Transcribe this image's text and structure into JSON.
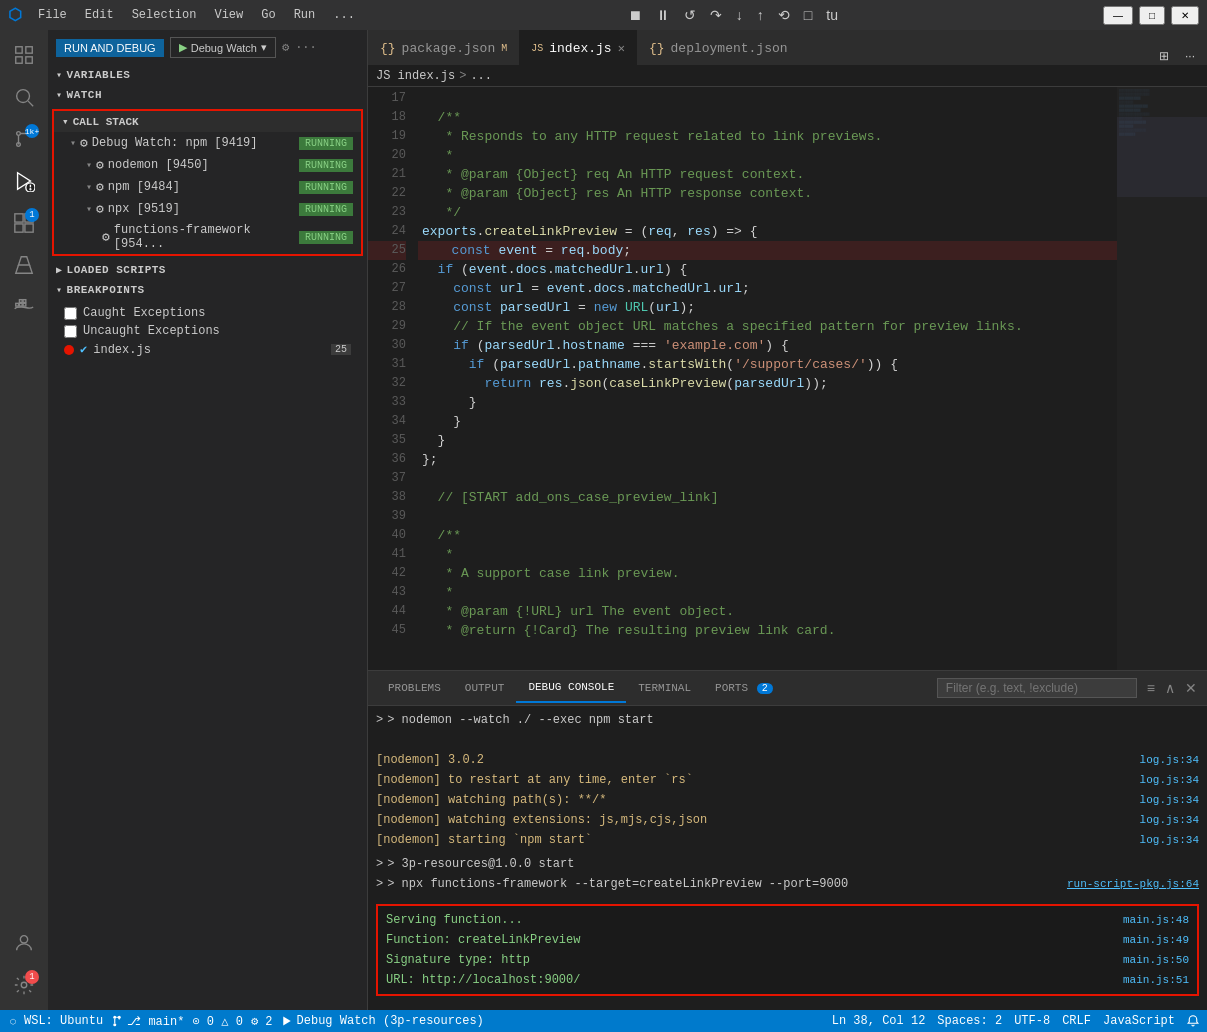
{
  "titleBar": {
    "logo": "⬡",
    "menus": [
      "File",
      "Edit",
      "Selection",
      "View",
      "Go",
      "Run",
      "..."
    ],
    "windowButtons": [
      "—",
      "□",
      "✕"
    ]
  },
  "debugControls": {
    "buttons": [
      "⏸",
      "⏸",
      "↺",
      "↓",
      "↑",
      "⟲",
      "□",
      "⬡",
      "tu"
    ]
  },
  "sidebar": {
    "runAndDebugLabel": "RUN AND DEBUG",
    "runBtn": "▶",
    "debugWatchLabel": "Debug Watch",
    "settingsIcon": "⚙",
    "moreIcon": "···",
    "variablesLabel": "VARIABLES",
    "watchLabel": "WATCH",
    "callStackLabel": "CALL STACK",
    "callStackItems": [
      {
        "label": "Debug Watch: npm [9419]",
        "status": "RUNNING",
        "level": 0
      },
      {
        "label": "nodemon [9450]",
        "status": "RUNNING",
        "level": 1
      },
      {
        "label": "npm [9484]",
        "status": "RUNNING",
        "level": 1
      },
      {
        "label": "npx [9519]",
        "status": "RUNNING",
        "level": 1
      },
      {
        "label": "functions-framework [954...",
        "status": "RUNNING",
        "level": 2
      }
    ],
    "loadedScriptsLabel": "LOADED SCRIPTS",
    "breakpointsLabel": "BREAKPOINTS",
    "breakpoints": [
      {
        "label": "Caught Exceptions",
        "checked": false,
        "type": "checkbox"
      },
      {
        "label": "Uncaught Exceptions",
        "checked": false,
        "type": "checkbox"
      },
      {
        "label": "index.js",
        "checked": true,
        "type": "dot",
        "count": "25"
      }
    ]
  },
  "tabs": [
    {
      "label": "package.json",
      "icon": "{}",
      "modified": true,
      "active": false
    },
    {
      "label": "index.js",
      "icon": "JS",
      "modified": false,
      "active": true,
      "close": true
    },
    {
      "label": "deployment.json",
      "icon": "{}",
      "modified": false,
      "active": false
    }
  ],
  "breadcrumb": {
    "parts": [
      "JS index.js",
      ">",
      "..."
    ]
  },
  "codeLines": [
    {
      "num": "17",
      "content": ""
    },
    {
      "num": "18",
      "tokens": [
        {
          "t": "cmt",
          "v": "  /**"
        }
      ]
    },
    {
      "num": "19",
      "tokens": [
        {
          "t": "cmt",
          "v": "   * Responds to any HTTP request related to link previews."
        }
      ]
    },
    {
      "num": "20",
      "tokens": [
        {
          "t": "cmt",
          "v": "   *"
        }
      ]
    },
    {
      "num": "21",
      "tokens": [
        {
          "t": "cmt",
          "v": "   * @param {Object} req An HTTP request context."
        }
      ]
    },
    {
      "num": "22",
      "tokens": [
        {
          "t": "cmt",
          "v": "   * @param {Object} res An HTTP response context."
        }
      ]
    },
    {
      "num": "23",
      "tokens": [
        {
          "t": "cmt",
          "v": "   */"
        }
      ]
    },
    {
      "num": "24",
      "tokens": [
        {
          "t": "var",
          "v": "exports"
        },
        {
          "t": "op",
          "v": "."
        },
        {
          "t": "fn",
          "v": "createLinkPreview"
        },
        {
          "t": "op",
          "v": " = ("
        },
        {
          "t": "param",
          "v": "req"
        },
        {
          "t": "op",
          "v": ", "
        },
        {
          "t": "param",
          "v": "res"
        },
        {
          "t": "op",
          "v": ") => {"
        }
      ]
    },
    {
      "num": "25",
      "tokens": [
        {
          "t": "op",
          "v": "  "
        },
        {
          "t": "kw",
          "v": "const"
        },
        {
          "t": "op",
          "v": " "
        },
        {
          "t": "var",
          "v": "event"
        },
        {
          "t": "op",
          "v": " = "
        },
        {
          "t": "var",
          "v": "req"
        },
        {
          "t": "op",
          "v": "."
        },
        {
          "t": "var",
          "v": "body"
        },
        {
          "t": "op",
          "v": ";"
        }
      ],
      "breakpoint": true
    },
    {
      "num": "26",
      "tokens": [
        {
          "t": "op",
          "v": "  "
        },
        {
          "t": "kw",
          "v": "if"
        },
        {
          "t": "op",
          "v": " ("
        },
        {
          "t": "var",
          "v": "event"
        },
        {
          "t": "op",
          "v": "."
        },
        {
          "t": "var",
          "v": "docs"
        },
        {
          "t": "op",
          "v": "."
        },
        {
          "t": "var",
          "v": "matchedUrl"
        },
        {
          "t": "op",
          "v": "."
        },
        {
          "t": "var",
          "v": "url"
        },
        {
          "t": "op",
          "v": ") {"
        }
      ]
    },
    {
      "num": "27",
      "tokens": [
        {
          "t": "op",
          "v": "    "
        },
        {
          "t": "kw",
          "v": "const"
        },
        {
          "t": "op",
          "v": " "
        },
        {
          "t": "var",
          "v": "url"
        },
        {
          "t": "op",
          "v": " = "
        },
        {
          "t": "var",
          "v": "event"
        },
        {
          "t": "op",
          "v": "."
        },
        {
          "t": "var",
          "v": "docs"
        },
        {
          "t": "op",
          "v": "."
        },
        {
          "t": "var",
          "v": "matchedUrl"
        },
        {
          "t": "op",
          "v": "."
        },
        {
          "t": "var",
          "v": "url"
        },
        {
          "t": "op",
          "v": ";"
        }
      ]
    },
    {
      "num": "28",
      "tokens": [
        {
          "t": "op",
          "v": "    "
        },
        {
          "t": "kw",
          "v": "const"
        },
        {
          "t": "op",
          "v": " "
        },
        {
          "t": "var",
          "v": "parsedUrl"
        },
        {
          "t": "op",
          "v": " = "
        },
        {
          "t": "kw",
          "v": "new"
        },
        {
          "t": "op",
          "v": " "
        },
        {
          "t": "type",
          "v": "URL"
        },
        {
          "t": "op",
          "v": "("
        },
        {
          "t": "var",
          "v": "url"
        },
        {
          "t": "op",
          "v": ");"
        }
      ]
    },
    {
      "num": "29",
      "tokens": [
        {
          "t": "cmt",
          "v": "    // If the event object URL matches a specified pattern for preview links."
        }
      ]
    },
    {
      "num": "30",
      "tokens": [
        {
          "t": "op",
          "v": "    "
        },
        {
          "t": "kw",
          "v": "if"
        },
        {
          "t": "op",
          "v": " ("
        },
        {
          "t": "var",
          "v": "parsedUrl"
        },
        {
          "t": "op",
          "v": "."
        },
        {
          "t": "var",
          "v": "hostname"
        },
        {
          "t": "op",
          "v": " === "
        },
        {
          "t": "str",
          "v": "'example.com'"
        },
        {
          "t": "op",
          "v": ") {"
        }
      ]
    },
    {
      "num": "31",
      "tokens": [
        {
          "t": "op",
          "v": "      "
        },
        {
          "t": "kw",
          "v": "if"
        },
        {
          "t": "op",
          "v": " ("
        },
        {
          "t": "var",
          "v": "parsedUrl"
        },
        {
          "t": "op",
          "v": "."
        },
        {
          "t": "var",
          "v": "pathname"
        },
        {
          "t": "op",
          "v": "."
        },
        {
          "t": "fn",
          "v": "startsWith"
        },
        {
          "t": "op",
          "v": "("
        },
        {
          "t": "str",
          "v": "'/support/cases/'"
        },
        {
          "t": "op",
          "v": ")) {"
        }
      ]
    },
    {
      "num": "32",
      "tokens": [
        {
          "t": "op",
          "v": "        "
        },
        {
          "t": "kw",
          "v": "return"
        },
        {
          "t": "op",
          "v": " "
        },
        {
          "t": "var",
          "v": "res"
        },
        {
          "t": "op",
          "v": "."
        },
        {
          "t": "fn",
          "v": "json"
        },
        {
          "t": "op",
          "v": "("
        },
        {
          "t": "fn",
          "v": "caseLinkPreview"
        },
        {
          "t": "op",
          "v": "("
        },
        {
          "t": "var",
          "v": "parsedUrl"
        },
        {
          "t": "op",
          "v": "));"
        }
      ]
    },
    {
      "num": "33",
      "tokens": [
        {
          "t": "op",
          "v": "      }"
        }
      ]
    },
    {
      "num": "34",
      "tokens": [
        {
          "t": "op",
          "v": "    }"
        }
      ]
    },
    {
      "num": "35",
      "tokens": [
        {
          "t": "op",
          "v": "  }"
        }
      ]
    },
    {
      "num": "36",
      "tokens": [
        {
          "t": "op",
          "v": "};"
        }
      ]
    },
    {
      "num": "37",
      "content": ""
    },
    {
      "num": "38",
      "tokens": [
        {
          "t": "cmt",
          "v": "  // [START add_ons_case_preview_link]"
        }
      ]
    },
    {
      "num": "39",
      "content": ""
    },
    {
      "num": "40",
      "tokens": [
        {
          "t": "cmt",
          "v": "  /**"
        }
      ]
    },
    {
      "num": "41",
      "tokens": [
        {
          "t": "cmt",
          "v": "   *"
        }
      ]
    },
    {
      "num": "42",
      "tokens": [
        {
          "t": "cmt",
          "v": "   * A support case link preview."
        }
      ]
    },
    {
      "num": "43",
      "tokens": [
        {
          "t": "cmt",
          "v": "   *"
        }
      ]
    },
    {
      "num": "44",
      "tokens": [
        {
          "t": "cmt",
          "v": "   * @param {!URL} url The event object."
        }
      ]
    },
    {
      "num": "45",
      "tokens": [
        {
          "t": "cmt",
          "v": "   * @return {!Card} The resulting preview link card."
        }
      ]
    }
  ],
  "panel": {
    "tabs": [
      "PROBLEMS",
      "OUTPUT",
      "DEBUG CONSOLE",
      "TERMINAL",
      "PORTS"
    ],
    "portsCount": "2",
    "activeTab": "DEBUG CONSOLE",
    "filterPlaceholder": "Filter (e.g. text, !exclude)",
    "consoleLines": [
      {
        "type": "cmd",
        "text": "> nodemon --watch ./ --exec npm start",
        "ref": ""
      },
      {
        "type": "blank",
        "text": "",
        "ref": ""
      },
      {
        "type": "yellow",
        "text": "[nodemon] 3.0.2",
        "ref": "log.js:34"
      },
      {
        "type": "yellow",
        "text": "[nodemon] to restart at any time, enter `rs`",
        "ref": "log.js:34"
      },
      {
        "type": "yellow",
        "text": "[nodemon] watching path(s): **/*",
        "ref": "log.js:34"
      },
      {
        "type": "yellow",
        "text": "[nodemon] watching extensions: js,mjs,cjs,json",
        "ref": "log.js:34"
      },
      {
        "type": "yellow",
        "text": "[nodemon] starting `npm start`",
        "ref": "log.js:34"
      },
      {
        "type": "blank",
        "text": "",
        "ref": ""
      },
      {
        "type": "cmd",
        "text": "> 3p-resources@1.0.0 start",
        "ref": ""
      },
      {
        "type": "cmd",
        "text": "> npx functions-framework --target=createLinkPreview --port=9000",
        "ref": ""
      },
      {
        "type": "blank",
        "text": "",
        "ref": ""
      }
    ],
    "highlightedLines": [
      {
        "text": "Serving function...",
        "ref": "main.js:48"
      },
      {
        "text": "Function: createLinkPreview",
        "ref": "main.js:49"
      },
      {
        "text": "Signature type: http",
        "ref": "main.js:50"
      },
      {
        "text": "URL: http://localhost:9000/",
        "ref": "main.js:51"
      }
    ]
  },
  "statusBar": {
    "left": [
      "WSL: Ubuntu",
      "⎇ main*",
      "⊙ 0 △ 0",
      "⚙ 2",
      "Debug Watch (3p-resources)"
    ],
    "right": [
      "Ln 38, Col 12",
      "Spaces: 2",
      "UTF-8",
      "CRLF",
      "JavaScript"
    ]
  },
  "activityBar": {
    "icons": [
      {
        "name": "explorer",
        "symbol": "⎘",
        "active": false
      },
      {
        "name": "search",
        "symbol": "🔍",
        "active": false
      },
      {
        "name": "source-control",
        "symbol": "⎇",
        "badge": "1k+"
      },
      {
        "name": "run-debug",
        "symbol": "▶",
        "active": true
      },
      {
        "name": "extensions",
        "symbol": "⊞",
        "badge": "1"
      },
      {
        "name": "testing",
        "symbol": "⚗",
        "active": false
      },
      {
        "name": "docker",
        "symbol": "🐋",
        "active": false
      },
      {
        "name": "account",
        "symbol": "👤",
        "bottom": true
      },
      {
        "name": "settings",
        "symbol": "⚙",
        "bottom": true,
        "badge": "1"
      }
    ]
  }
}
